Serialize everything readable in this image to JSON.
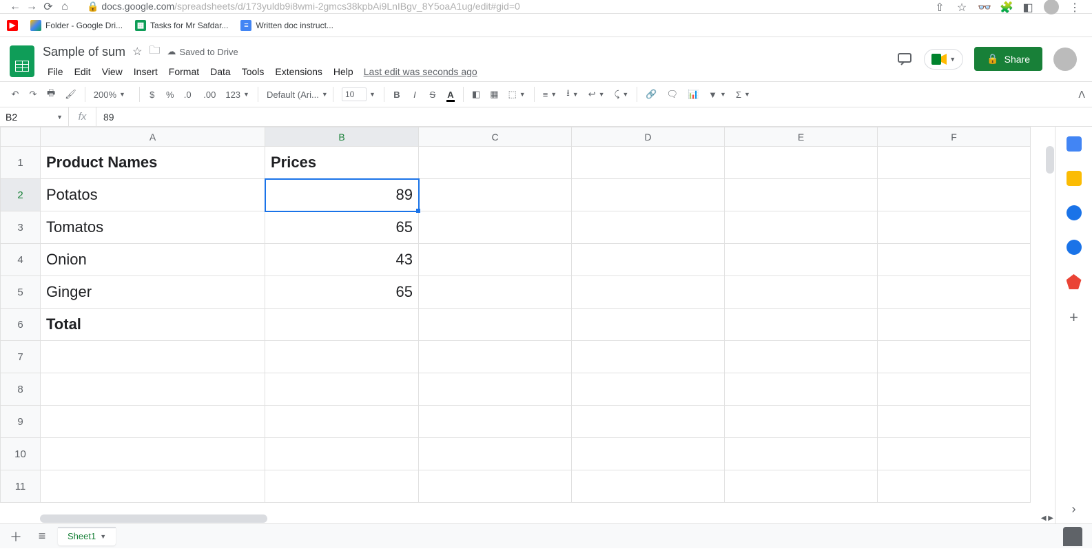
{
  "browser": {
    "url_prefix": "docs.google.com",
    "url_rest": "/spreadsheets/d/173yuldb9i8wmi-2gmcs38kpbAi9LnIBgv_8Y5oaA1ug/edit#gid=0"
  },
  "bookmarks": [
    {
      "label": ""
    },
    {
      "label": "Folder - Google Dri..."
    },
    {
      "label": "Tasks for Mr Safdar..."
    },
    {
      "label": "Written doc instruct..."
    }
  ],
  "doc": {
    "title": "Sample of sum",
    "saved": "Saved to Drive",
    "last_edit": "Last edit was seconds ago",
    "share": "Share"
  },
  "menus": [
    "File",
    "Edit",
    "View",
    "Insert",
    "Format",
    "Data",
    "Tools",
    "Extensions",
    "Help"
  ],
  "toolbar": {
    "zoom": "200%",
    "font": "Default (Ari...",
    "size": "10"
  },
  "namebox": {
    "ref": "B2",
    "formula": "89"
  },
  "columns": [
    "A",
    "B",
    "C",
    "D",
    "E",
    "F"
  ],
  "rows": [
    "1",
    "2",
    "3",
    "4",
    "5",
    "6",
    "7",
    "8",
    "9",
    "10",
    "11"
  ],
  "selected": {
    "col": "B",
    "row": "2"
  },
  "cells": {
    "A1": "Product Names",
    "B1": "Prices",
    "A2": "Potatos",
    "B2": "89",
    "A3": "Tomatos",
    "B3": "65",
    "A4": "Onion",
    "B4": "43",
    "A5": "Ginger",
    "B5": "65",
    "A6": "Total"
  },
  "bold_cells": [
    "A1",
    "B1",
    "A6"
  ],
  "right_align_cells": [
    "B2",
    "B3",
    "B4",
    "B5"
  ],
  "sheet_tab": "Sheet1"
}
